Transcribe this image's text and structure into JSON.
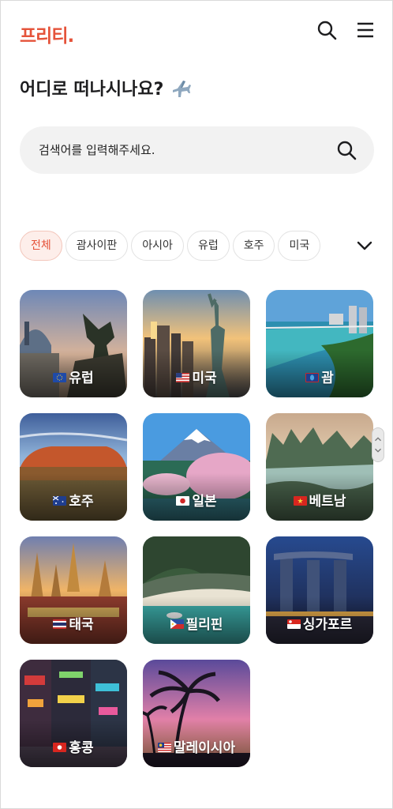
{
  "header": {
    "logo": "프리티.",
    "icons": [
      "search-icon",
      "menu-icon"
    ]
  },
  "title": "어디로 떠나시나요?",
  "title_icon": "airplane-icon",
  "search": {
    "placeholder": "검색어를 입력해주세요.",
    "icon": "search-icon"
  },
  "categories": {
    "items": [
      "전체",
      "괌사이판",
      "아시아",
      "유럽",
      "호주",
      "미국"
    ],
    "selected": "전체",
    "expand_icon": "chevron-down-icon"
  },
  "destinations": [
    {
      "label": "유럽",
      "flag": "eu-flag"
    },
    {
      "label": "미국",
      "flag": "us-flag"
    },
    {
      "label": "괌",
      "flag": "guam-flag"
    },
    {
      "label": "호주",
      "flag": "au-flag"
    },
    {
      "label": "일본",
      "flag": "jp-flag"
    },
    {
      "label": "베트남",
      "flag": "vn-flag"
    },
    {
      "label": "태국",
      "flag": "th-flag"
    },
    {
      "label": "필리핀",
      "flag": "ph-flag"
    },
    {
      "label": "싱가포르",
      "flag": "sg-flag"
    },
    {
      "label": "홍콩",
      "flag": "hk-flag"
    },
    {
      "label": "말레이시아",
      "flag": "my-flag"
    }
  ],
  "colors": {
    "accent": "#e5533a",
    "chip_active_bg": "#fdeeea",
    "search_bg": "#f2f2f2"
  }
}
